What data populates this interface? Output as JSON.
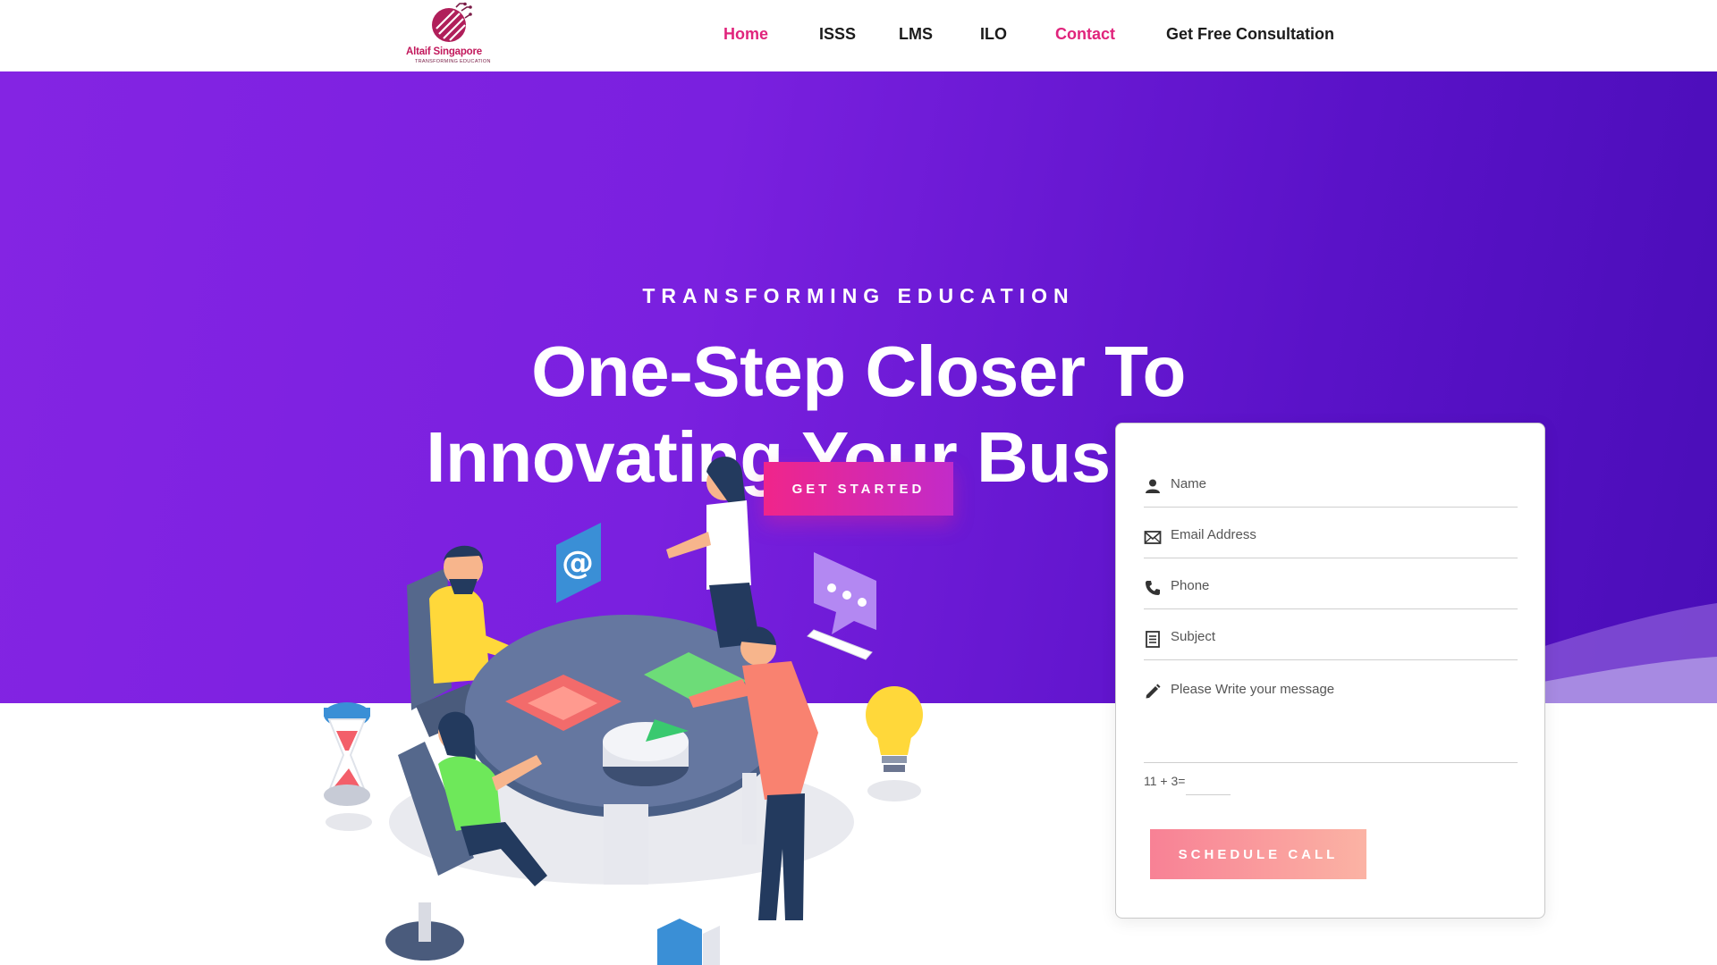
{
  "brand": {
    "name": "Altaif Singapore",
    "tagline": "TRANSFORMING EDUCATION",
    "primary_color": "#e0247c",
    "hero_gradient": [
      "#8424e3",
      "#4a0db8"
    ]
  },
  "nav": {
    "items": [
      {
        "label": "Home",
        "active": true
      },
      {
        "label": "ISSS",
        "active": false
      },
      {
        "label": "LMS",
        "active": false
      },
      {
        "label": "ILO",
        "active": false
      },
      {
        "label": "Contact",
        "active": true
      },
      {
        "label": "Get Free Consultation",
        "active": false
      }
    ]
  },
  "hero": {
    "eyebrow": "TRANSFORMING EDUCATION",
    "headline_line1": "One-Step Closer To",
    "headline_line2": "Innovating Your Business",
    "cta_label": "GET STARTED"
  },
  "form": {
    "fields": [
      {
        "placeholder": "Name",
        "icon": "user-icon"
      },
      {
        "placeholder": "Email Address",
        "icon": "envelope-icon"
      },
      {
        "placeholder": "Phone",
        "icon": "phone-icon"
      },
      {
        "placeholder": "Subject",
        "icon": "document-icon"
      },
      {
        "placeholder": "Please Write your message",
        "icon": "pencil-icon"
      }
    ],
    "captcha_label": "11 + 3=",
    "submit_label": "SCHEDULE CALL"
  }
}
